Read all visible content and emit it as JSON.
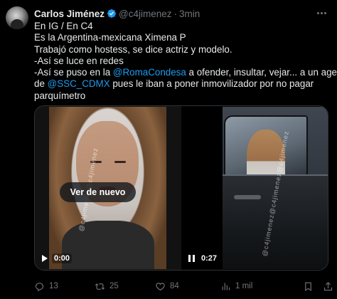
{
  "post": {
    "author_name": "Carlos Jiménez",
    "handle": "@c4jimenez",
    "separator": "·",
    "time": "3min",
    "lines": [
      "En IG / En C4",
      "Es la Argentina-mexicana Ximena P",
      "Trabajó como hostess, se dice actriz y modelo.",
      "-Así se luce en redes"
    ],
    "line5_pre": "-Así se puso en la ",
    "line5_mention": "@RomaCondesa",
    "line5_post": " a ofender, insultar, vejar... a un agente",
    "line6_pre": "de ",
    "line6_mention": "@SSC_CDMX",
    "line6_post": " pues le iban a poner inmovilizador por no pagar",
    "line7": "parquímetro"
  },
  "media": {
    "left": {
      "replay_label": "Ver de nuevo",
      "time": "0:00",
      "watermark": "@c4jimenez@c4jimenez"
    },
    "right": {
      "time": "0:27",
      "watermark": "@c4jimenez@c4jimenez@c4jimenez"
    }
  },
  "actions": {
    "replies": "13",
    "reposts": "25",
    "likes": "84",
    "views": "1 mil"
  },
  "colors": {
    "background": "#000000",
    "text": "#e7e9ea",
    "muted": "#71767b",
    "accent": "#1d9bf0",
    "border": "#2f3336"
  }
}
